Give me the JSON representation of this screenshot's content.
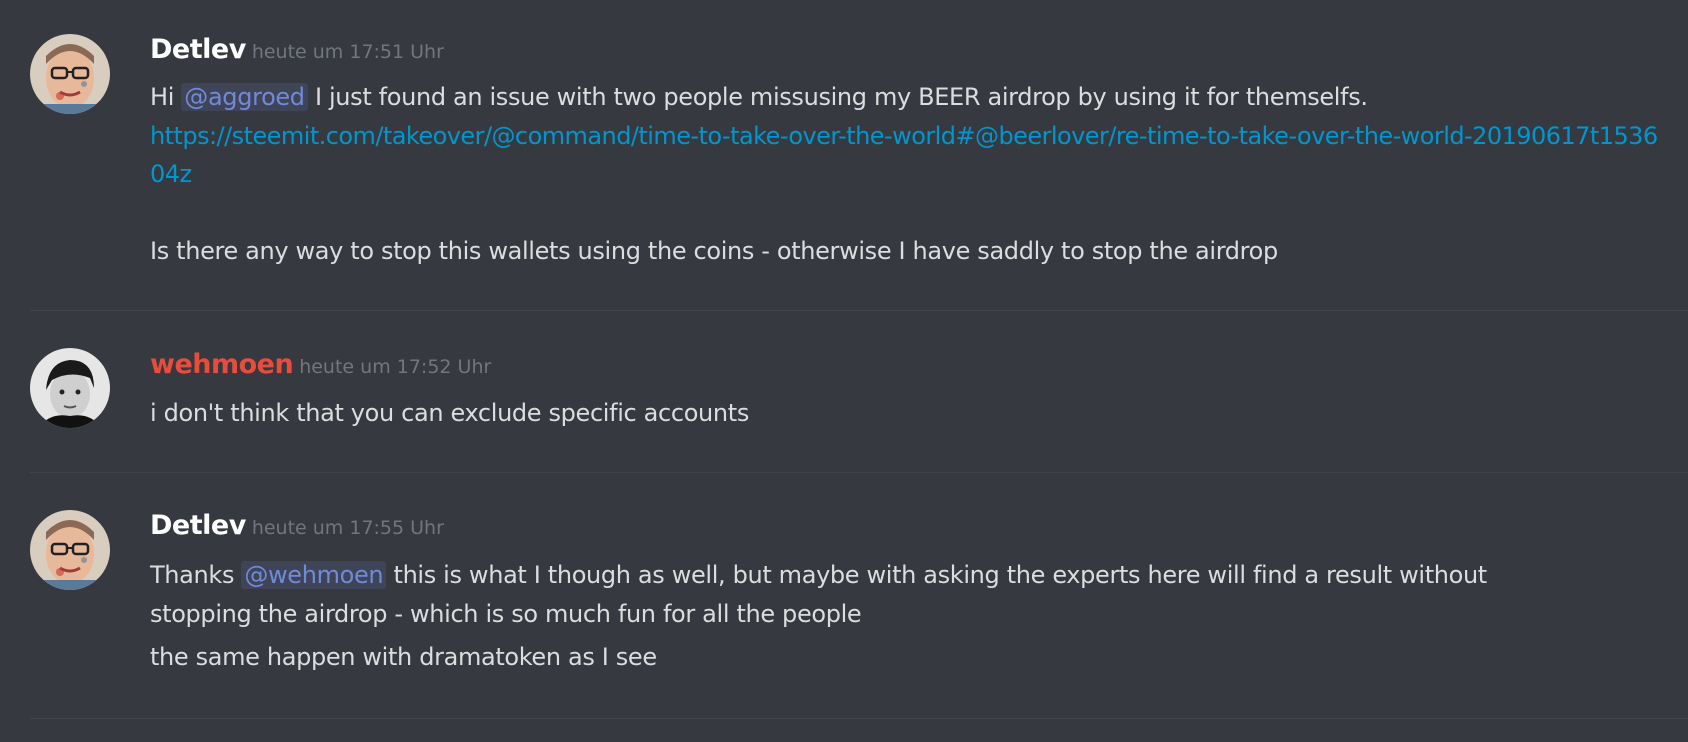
{
  "messages": [
    {
      "author": "Detlev",
      "author_color": "#ffffff",
      "timestamp": "heute um 17:51 Uhr",
      "line1_pre": "Hi ",
      "line1_mention": "@aggroed",
      "line1_post": " I just found an issue with two people missusing my BEER airdrop by using it for themselfs.",
      "link": "https://steemit.com/takeover/@command/time-to-take-over-the-world#@beerlover/re-time-to-take-over-the-world-20190617t153604z",
      "line2": "Is there any way to stop this wallets using the coins - otherwise I have saddly to stop the airdrop"
    },
    {
      "author": "wehmoen",
      "author_color": "#e74c3c",
      "timestamp": "heute um 17:52 Uhr",
      "line1": "i don't think that you can exclude specific accounts"
    },
    {
      "author": "Detlev",
      "author_color": "#ffffff",
      "timestamp": "heute um 17:55 Uhr",
      "line1_pre": "Thanks ",
      "line1_mention": "@wehmoen",
      "line1_post": " this is what I though as well, but maybe with asking the experts here will find a result without stopping the airdrop - which is so much fun for all the people",
      "line2": "the same happen with dramatoken as I see"
    }
  ],
  "colors": {
    "background": "#36393f",
    "mention_text": "#7289da",
    "link": "#0096cf",
    "timestamp": "#72767d"
  }
}
